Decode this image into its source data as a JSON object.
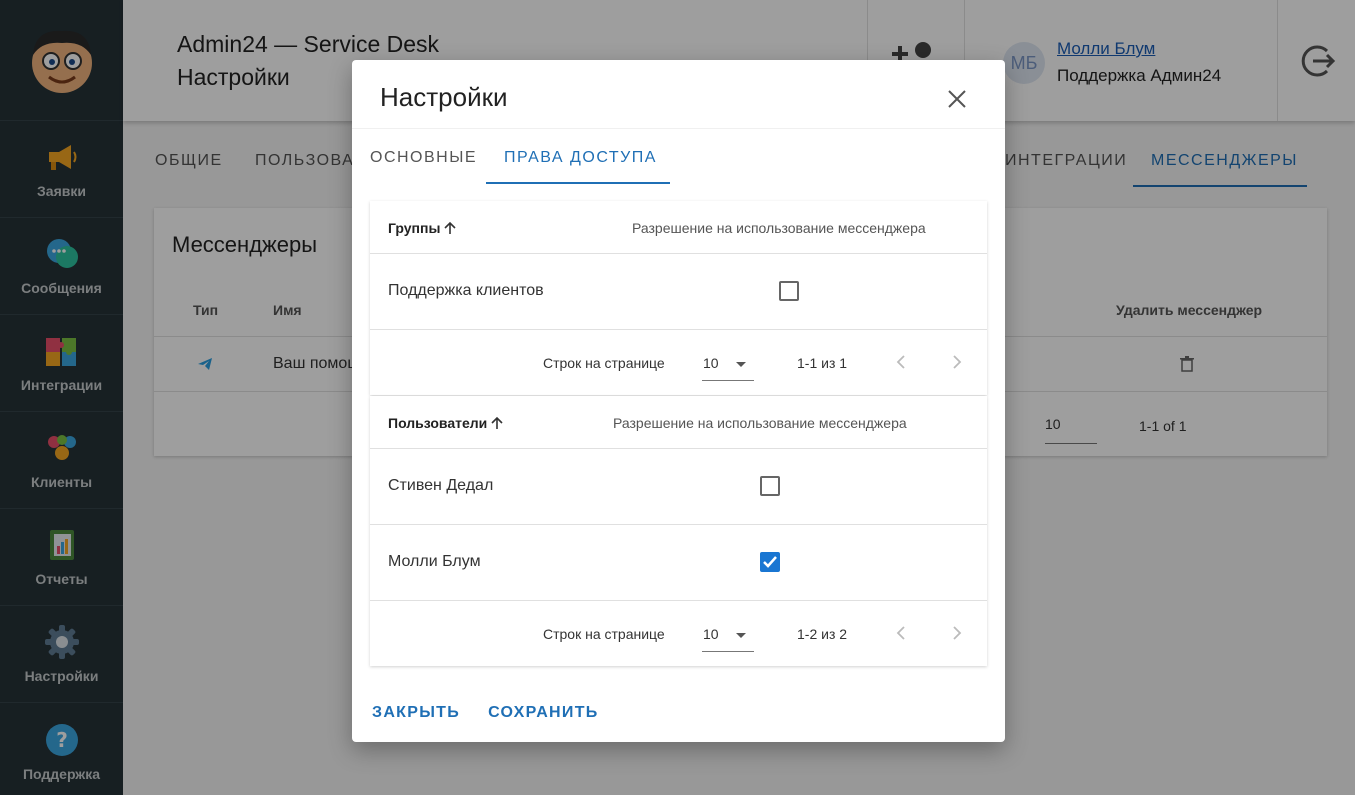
{
  "sidebar": {
    "items": [
      {
        "label": "Заявки",
        "icon": "megaphone-icon"
      },
      {
        "label": "Сообщения",
        "icon": "chat-bubbles-icon"
      },
      {
        "label": "Интеграции",
        "icon": "puzzle-icon"
      },
      {
        "label": "Клиенты",
        "icon": "people-icon"
      },
      {
        "label": "Отчеты",
        "icon": "report-book-icon"
      },
      {
        "label": "Настройки",
        "icon": "gear-icon"
      },
      {
        "label": "Поддержка",
        "icon": "help-icon"
      }
    ]
  },
  "header": {
    "title_line1": "Admin24 — Service Desk",
    "title_line2": "Настройки",
    "user_initials": "МБ",
    "user_name": "Молли Блум",
    "user_role": "Поддержка Админ24"
  },
  "background": {
    "tabs": [
      "ОБЩИЕ",
      "ПОЛЬЗОВАТ",
      "ИНТЕГРАЦИИ",
      "МЕССЕНДЖЕРЫ"
    ],
    "card_title": "Мессенджеры",
    "columns": {
      "type": "Тип",
      "name": "Имя",
      "delete": "Удалить мессенджер"
    },
    "row_name": "Ваш помощ",
    "rows_per_page": "10",
    "range": "1-1 of 1"
  },
  "dialog": {
    "title": "Настройки",
    "tabs": [
      "ОСНОВНЫЕ",
      "ПРАВА ДОСТУПА"
    ],
    "active_tab": "ПРАВА ДОСТУПА",
    "groups_table": {
      "header_name": "Группы",
      "header_perm": "Разрешение на использование мессенджера",
      "rows": [
        {
          "name": "Поддержка клиентов",
          "checked": false
        }
      ],
      "footer": {
        "label": "Строк на странице",
        "rows_per_page": "10",
        "range": "1-1 из 1"
      }
    },
    "users_table": {
      "header_name": "Пользователи",
      "header_perm": "Разрешение на использование мессенджера",
      "rows": [
        {
          "name": "Стивен Дедал",
          "checked": false
        },
        {
          "name": "Молли Блум",
          "checked": true
        }
      ],
      "footer": {
        "label": "Строк на странице",
        "rows_per_page": "10",
        "range": "1-2 из 2"
      }
    },
    "actions": {
      "close": "ЗАКРЫТЬ",
      "save": "СОХРАНИТЬ"
    }
  },
  "colors": {
    "accent": "#1f6fb5",
    "sidebar_bg": "#263238",
    "checkbox_checked": "#1976d2"
  }
}
